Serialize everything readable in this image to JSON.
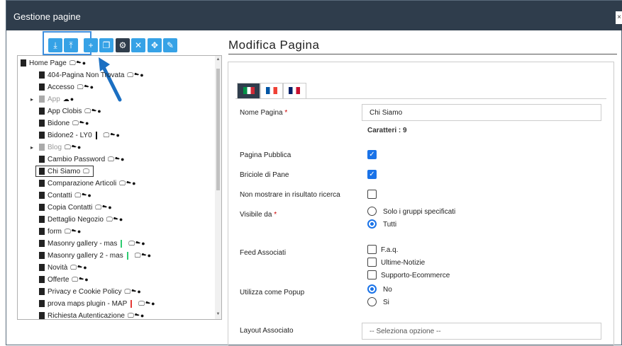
{
  "window": {
    "title": "Gestione pagine",
    "close_label": "×"
  },
  "toolbar": {
    "buttons": [
      {
        "icon": "download",
        "glyph": "⤓"
      },
      {
        "icon": "upload",
        "glyph": "⤒"
      },
      {
        "icon": "add",
        "glyph": "+"
      },
      {
        "icon": "copy",
        "glyph": "❐"
      },
      {
        "icon": "settings",
        "glyph": "⚙"
      },
      {
        "icon": "delete",
        "glyph": "✕"
      },
      {
        "icon": "move",
        "glyph": "✥"
      },
      {
        "icon": "edit",
        "glyph": "✎"
      }
    ]
  },
  "tree": {
    "items": [
      {
        "label": "Home Page",
        "devices": "🖵☁●",
        "grey": false,
        "caret": "",
        "selected": false
      },
      {
        "label": "404-Pagina Non Trovata",
        "devices": "🖵☁●",
        "grey": false,
        "caret": "",
        "selected": false
      },
      {
        "label": "Accesso",
        "devices": "🖵☁●",
        "grey": false,
        "caret": "",
        "selected": false
      },
      {
        "label": "App",
        "devices": "☁●",
        "grey": true,
        "caret": "▸",
        "selected": false
      },
      {
        "label": "App Clobis",
        "devices": "🖵☁●",
        "grey": false,
        "caret": "",
        "selected": false
      },
      {
        "label": "Bidone",
        "devices": "🖵☁●",
        "grey": false,
        "caret": "",
        "selected": false
      },
      {
        "label": "Bidone2 - LY0",
        "devices": "🖵☁●",
        "grey": false,
        "caret": "",
        "selected": false,
        "sep": "#111"
      },
      {
        "label": "Blog",
        "devices": "🖵☁●",
        "grey": true,
        "caret": "▸",
        "selected": false
      },
      {
        "label": "Cambio Password",
        "devices": "🖵☁●",
        "grey": false,
        "caret": "",
        "selected": false
      },
      {
        "label": "Chi Siamo",
        "devices": "🖵",
        "grey": false,
        "caret": "",
        "selected": true
      },
      {
        "label": "Comparazione Articoli",
        "devices": "🖵☁●",
        "grey": false,
        "caret": "",
        "selected": false
      },
      {
        "label": "Contatti",
        "devices": "🖵☁●",
        "grey": false,
        "caret": "",
        "selected": false
      },
      {
        "label": "Copia Contatti",
        "devices": "🖵☁●",
        "grey": false,
        "caret": "",
        "selected": false
      },
      {
        "label": "Dettaglio Negozio",
        "devices": "🖵☁●",
        "grey": false,
        "caret": "",
        "selected": false
      },
      {
        "label": "form",
        "devices": "🖵☁●",
        "grey": false,
        "caret": "",
        "selected": false
      },
      {
        "label": "Masonry gallery - mas",
        "devices": "🖵☁●",
        "grey": false,
        "caret": "",
        "selected": false,
        "sep": "#2ecc71"
      },
      {
        "label": "Masonry gallery 2 - mas",
        "devices": "🖵☁●",
        "grey": false,
        "caret": "",
        "selected": false,
        "sep": "#2ecc71"
      },
      {
        "label": "Novità",
        "devices": "🖵☁●",
        "grey": false,
        "caret": "",
        "selected": false
      },
      {
        "label": "Offerte",
        "devices": "🖵☁●",
        "grey": false,
        "caret": "",
        "selected": false
      },
      {
        "label": "Privacy e Cookie Policy",
        "devices": "🖵☁●",
        "grey": false,
        "caret": "",
        "selected": false
      },
      {
        "label": "prova maps plugin - MAP",
        "devices": "🖵☁●",
        "grey": false,
        "caret": "",
        "selected": false,
        "sep": "#e53935"
      },
      {
        "label": "Richiesta Autenticazione",
        "devices": "🖵☁●",
        "grey": false,
        "caret": "",
        "selected": false
      }
    ]
  },
  "panel": {
    "title": "Modifica Pagina",
    "flags": [
      {
        "name": "italian-flag",
        "colors": [
          "#009246",
          "#ffffff",
          "#ce2b37"
        ]
      },
      {
        "name": "french-flag",
        "colors": [
          "#0055a4",
          "#ffffff",
          "#ef4135"
        ]
      },
      {
        "name": "uk-flag",
        "colors": [
          "#012169",
          "#ffffff",
          "#c8102e"
        ]
      }
    ],
    "nome_pagina_label": "Nome Pagina",
    "nome_pagina_value": "Chi Siamo",
    "caratteri": "Caratteri : 9",
    "pagina_pubblica_label": "Pagina Pubblica",
    "briciole_label": "Briciole di Pane",
    "non_mostrare_label": "Non mostrare in risultato ricerca",
    "visibile_label": "Visibile da",
    "visibile_opt1": "Solo i gruppi specificati",
    "visibile_opt2": "Tutti",
    "feed_label": "Feed Associati",
    "feed_opt1": "F.a.q.",
    "feed_opt2": "Ultime-Notizie",
    "feed_opt3": "Supporto-Ecommerce",
    "popup_label": "Utilizza come Popup",
    "popup_opt1": "No",
    "popup_opt2": "Si",
    "layout_label": "Layout Associato",
    "layout_value": "-- Seleziona opzione --",
    "required_mark": "*"
  },
  "colors": {
    "accent": "#36a2e6",
    "titlebar": "#2f3d4c",
    "check": "#1a73e8"
  }
}
